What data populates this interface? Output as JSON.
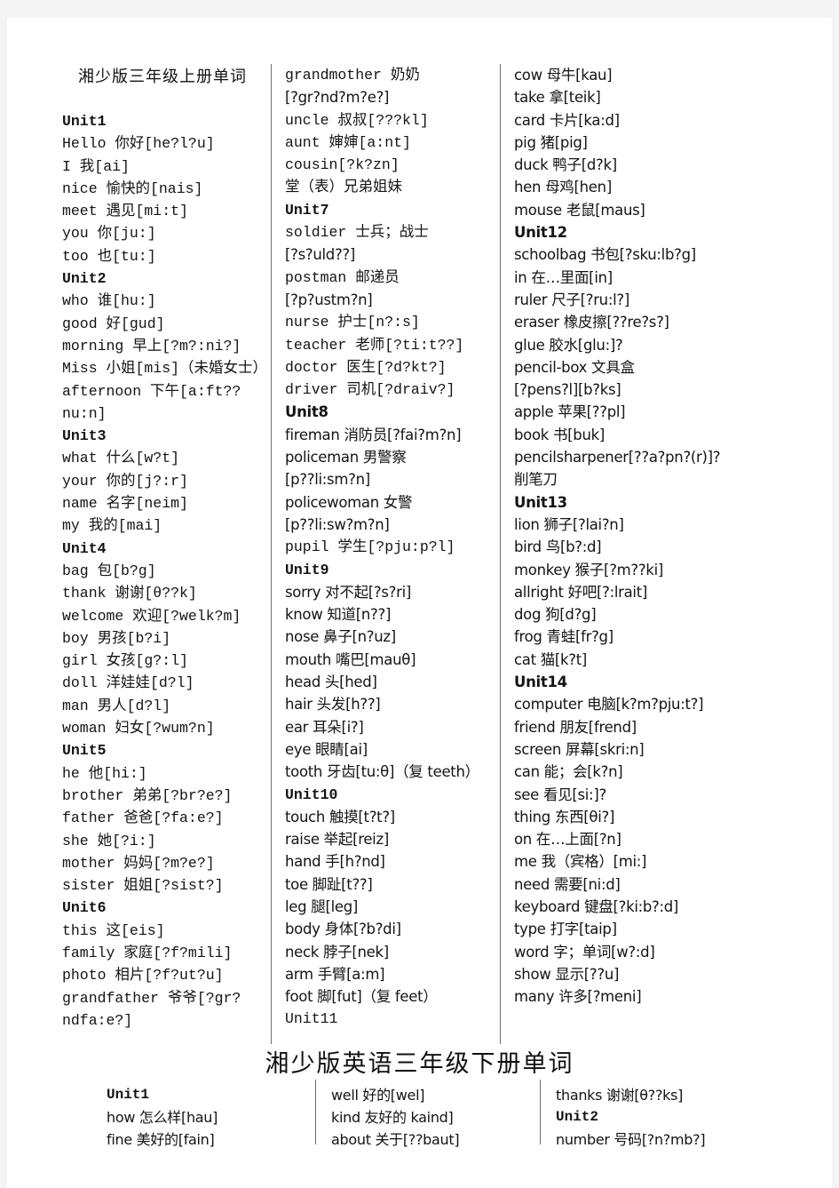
{
  "page": {
    "background": "#ffffff",
    "surround": "#f4f4f4",
    "text_color": "#141414",
    "rule_color": "#6f6f6f"
  },
  "section1": {
    "title": "湘少版三年级上册单词",
    "columns": [
      {
        "name": "column-1",
        "font": "mono",
        "lines": [
          {
            "text": "Unit1",
            "bold": true,
            "font": "mono"
          },
          {
            "text": "Hello 你好[he?l?u]",
            "bold": false,
            "font": "mono"
          },
          {
            "text": "I 我[ai]",
            "bold": false,
            "font": "mono"
          },
          {
            "text": "nice 愉快的[nais]",
            "bold": false,
            "font": "mono"
          },
          {
            "text": "meet 遇见[mi:t]",
            "bold": false,
            "font": "mono"
          },
          {
            "text": "you 你[ju:]",
            "bold": false,
            "font": "mono"
          },
          {
            "text": "too 也[tu:]",
            "bold": false,
            "font": "mono"
          },
          {
            "text": "Unit2",
            "bold": true,
            "font": "mono"
          },
          {
            "text": "who 谁[hu:]",
            "bold": false,
            "font": "mono"
          },
          {
            "text": "good 好[gud]",
            "bold": false,
            "font": "mono"
          },
          {
            "text": "morning 早上[?m?:ni?]",
            "bold": false,
            "font": "mono"
          },
          {
            "text": "Miss 小姐[mis]（未婚女士）",
            "bold": false,
            "font": "mono"
          },
          {
            "text": "afternoon 下午[a:ft??nu:n]",
            "bold": false,
            "font": "mono"
          },
          {
            "text": "Unit3",
            "bold": true,
            "font": "mono"
          },
          {
            "text": "what 什么[w?t]",
            "bold": false,
            "font": "mono"
          },
          {
            "text": "your 你的[j?:r]",
            "bold": false,
            "font": "mono"
          },
          {
            "text": "name 名字[neim]",
            "bold": false,
            "font": "mono"
          },
          {
            "text": "my 我的[mai]",
            "bold": false,
            "font": "mono"
          },
          {
            "text": "Unit4",
            "bold": true,
            "font": "mono"
          },
          {
            "text": "bag 包[b?g]",
            "bold": false,
            "font": "mono"
          },
          {
            "text": "thank 谢谢[θ??k]",
            "bold": false,
            "font": "mono"
          },
          {
            "text": "welcome 欢迎[?welk?m]",
            "bold": false,
            "font": "mono"
          },
          {
            "text": "boy 男孩[b?i]",
            "bold": false,
            "font": "mono"
          },
          {
            "text": "girl 女孩[g?:l]",
            "bold": false,
            "font": "mono"
          },
          {
            "text": "doll 洋娃娃[d?l]",
            "bold": false,
            "font": "mono"
          },
          {
            "text": "man 男人[d?l]",
            "bold": false,
            "font": "mono"
          },
          {
            "text": "woman 妇女[?wum?n]",
            "bold": false,
            "font": "mono"
          },
          {
            "text": "Unit5",
            "bold": true,
            "font": "mono"
          },
          {
            "text": "he 他[hi:]",
            "bold": false,
            "font": "mono"
          },
          {
            "text": "brother 弟弟[?br?e?]",
            "bold": false,
            "font": "mono"
          },
          {
            "text": "father 爸爸[?fa:e?]",
            "bold": false,
            "font": "mono"
          },
          {
            "text": "she 她[?i:]",
            "bold": false,
            "font": "mono"
          },
          {
            "text": "mother 妈妈[?m?e?]",
            "bold": false,
            "font": "mono"
          },
          {
            "text": "sister 姐姐[?sist?]",
            "bold": false,
            "font": "mono"
          },
          {
            "text": "Unit6",
            "bold": true,
            "font": "mono"
          },
          {
            "text": "this 这[eis]",
            "bold": false,
            "font": "mono"
          },
          {
            "text": "family 家庭[?f?mili]",
            "bold": false,
            "font": "mono"
          },
          {
            "text": "photo 相片[?f?ut?u]",
            "bold": false,
            "font": "mono"
          },
          {
            "text": "grandfather 爷爷[?gr?ndfa:e?]",
            "bold": false,
            "font": "mono"
          }
        ]
      },
      {
        "name": "column-2",
        "font": "mixed",
        "lines": [
          {
            "text": "grandmother 奶奶",
            "bold": false,
            "font": "mono"
          },
          {
            "text": "[?gr?nd?m?e?]",
            "bold": false,
            "font": "sans"
          },
          {
            "text": "uncle 叔叔[???kl]",
            "bold": false,
            "font": "mono"
          },
          {
            "text": "aunt 婶婶[a:nt]",
            "bold": false,
            "font": "mono"
          },
          {
            "text": "cousin[?k?zn]",
            "bold": false,
            "font": "mono"
          },
          {
            "text": "堂（表）兄弟姐妹",
            "bold": false,
            "font": "mono"
          },
          {
            "text": "Unit7",
            "bold": true,
            "font": "mono"
          },
          {
            "text": "soldier 士兵；战士",
            "bold": false,
            "font": "mono"
          },
          {
            "text": "[?s?uld??]",
            "bold": false,
            "font": "sans"
          },
          {
            "text": "postman 邮递员",
            "bold": false,
            "font": "mono"
          },
          {
            "text": "[?p?ustm?n]",
            "bold": false,
            "font": "sans"
          },
          {
            "text": "nurse 护士[n?:s]",
            "bold": false,
            "font": "mono"
          },
          {
            "text": "teacher 老师[?ti:t??]",
            "bold": false,
            "font": "mono"
          },
          {
            "text": "doctor 医生[?d?kt?]",
            "bold": false,
            "font": "mono"
          },
          {
            "text": "driver 司机[?draiv?]",
            "bold": false,
            "font": "mono"
          },
          {
            "text": "Unit8",
            "bold": true,
            "font": "sans"
          },
          {
            "text": "fireman 消防员[?fai?m?n]",
            "bold": false,
            "font": "sans"
          },
          {
            "text": "policeman 男警察",
            "bold": false,
            "font": "sans"
          },
          {
            "text": "[p??li:sm?n]",
            "bold": false,
            "font": "sans"
          },
          {
            "text": "policewoman 女警",
            "bold": false,
            "font": "sans"
          },
          {
            "text": "[p??li:sw?m?n]",
            "bold": false,
            "font": "sans"
          },
          {
            "text": "pupil 学生[?pju:p?l]",
            "bold": false,
            "font": "mono"
          },
          {
            "text": "Unit9",
            "bold": true,
            "font": "mono"
          },
          {
            "text": "sorry 对不起[?s?ri]",
            "bold": false,
            "font": "sans"
          },
          {
            "text": "know 知道[n??]",
            "bold": false,
            "font": "sans"
          },
          {
            "text": "nose 鼻子[n?uz]",
            "bold": false,
            "font": "sans"
          },
          {
            "text": "mouth 嘴巴[mauθ]",
            "bold": false,
            "font": "sans"
          },
          {
            "text": "head 头[hed]",
            "bold": false,
            "font": "sans"
          },
          {
            "text": "hair 头发[h??]",
            "bold": false,
            "font": "sans"
          },
          {
            "text": "ear 耳朵[i?]",
            "bold": false,
            "font": "sans"
          },
          {
            "text": "eye 眼睛[ai]",
            "bold": false,
            "font": "sans"
          },
          {
            "text": "tooth 牙齿[tu:θ]（复 teeth）",
            "bold": false,
            "font": "sans"
          },
          {
            "text": "Unit10",
            "bold": true,
            "font": "mono"
          },
          {
            "text": "touch 触摸[t?t?]",
            "bold": false,
            "font": "sans"
          },
          {
            "text": "raise 举起[reiz]",
            "bold": false,
            "font": "sans"
          },
          {
            "text": "hand 手[h?nd]",
            "bold": false,
            "font": "sans"
          },
          {
            "text": "toe 脚趾[t??]",
            "bold": false,
            "font": "sans"
          },
          {
            "text": "leg 腿[leg]",
            "bold": false,
            "font": "sans"
          },
          {
            "text": "body 身体[?b?di]",
            "bold": false,
            "font": "sans"
          },
          {
            "text": "neck 脖子[nek]",
            "bold": false,
            "font": "sans"
          },
          {
            "text": "arm 手臂[a:m]",
            "bold": false,
            "font": "sans"
          },
          {
            "text": "foot 脚[fut]（复 feet）",
            "bold": false,
            "font": "sans"
          },
          {
            "text": "Unit11",
            "bold": false,
            "font": "mono"
          }
        ]
      },
      {
        "name": "column-3",
        "font": "sans",
        "lines": [
          {
            "text": "cow 母牛[kau]",
            "bold": false,
            "font": "sans"
          },
          {
            "text": "take 拿[teik]",
            "bold": false,
            "font": "sans"
          },
          {
            "text": "card 卡片[ka:d]",
            "bold": false,
            "font": "sans"
          },
          {
            "text": "pig 猪[pig]",
            "bold": false,
            "font": "sans"
          },
          {
            "text": "duck 鸭子[d?k]",
            "bold": false,
            "font": "sans"
          },
          {
            "text": "hen 母鸡[hen]",
            "bold": false,
            "font": "sans"
          },
          {
            "text": "mouse 老鼠[maus]",
            "bold": false,
            "font": "sans"
          },
          {
            "text": "Unit12",
            "bold": true,
            "font": "sans"
          },
          {
            "text": "schoolbag 书包[?sku:lb?g]",
            "bold": false,
            "font": "sans"
          },
          {
            "text": "in 在…里面[in]",
            "bold": false,
            "font": "sans"
          },
          {
            "text": "ruler 尺子[?ru:l?]",
            "bold": false,
            "font": "sans"
          },
          {
            "text": "eraser 橡皮擦[??re?s?]",
            "bold": false,
            "font": "sans"
          },
          {
            "text": "glue 胶水[glu:]?",
            "bold": false,
            "font": "sans"
          },
          {
            "text": "pencil-box 文具盒",
            "bold": false,
            "font": "sans"
          },
          {
            "text": "[?pens?l][b?ks]",
            "bold": false,
            "font": "sans"
          },
          {
            "text": "apple 苹果[??pl]",
            "bold": false,
            "font": "sans"
          },
          {
            "text": "book 书[buk]",
            "bold": false,
            "font": "sans"
          },
          {
            "text": "pencilsharpener[??a?pn?(r)]?",
            "bold": false,
            "font": "sans"
          },
          {
            "text": "削笔刀",
            "bold": false,
            "font": "sans"
          },
          {
            "text": "Unit13",
            "bold": true,
            "font": "sans"
          },
          {
            "text": "lion 狮子[?lai?n]",
            "bold": false,
            "font": "sans"
          },
          {
            "text": "bird 鸟[b?:d]",
            "bold": false,
            "font": "sans"
          },
          {
            "text": "monkey 猴子[?m??ki]",
            "bold": false,
            "font": "sans"
          },
          {
            "text": "allright 好吧[?:lrait]",
            "bold": false,
            "font": "sans"
          },
          {
            "text": "dog 狗[d?g]",
            "bold": false,
            "font": "sans"
          },
          {
            "text": "frog 青蛙[fr?g]",
            "bold": false,
            "font": "sans"
          },
          {
            "text": "cat 猫[k?t]",
            "bold": false,
            "font": "sans"
          },
          {
            "text": "Unit14",
            "bold": true,
            "font": "sans"
          },
          {
            "text": "computer 电脑[k?m?pju:t?]",
            "bold": false,
            "font": "sans"
          },
          {
            "text": "friend 朋友[frend]",
            "bold": false,
            "font": "sans"
          },
          {
            "text": "screen 屏幕[skri:n]",
            "bold": false,
            "font": "sans"
          },
          {
            "text": "can 能；会[k?n]",
            "bold": false,
            "font": "sans"
          },
          {
            "text": "see 看见[si:]?",
            "bold": false,
            "font": "sans"
          },
          {
            "text": "thing 东西[θi?]",
            "bold": false,
            "font": "sans"
          },
          {
            "text": "on 在…上面[?n]",
            "bold": false,
            "font": "sans"
          },
          {
            "text": "me 我（宾格）[mi:]",
            "bold": false,
            "font": "sans"
          },
          {
            "text": "need 需要[ni:d]",
            "bold": false,
            "font": "sans"
          },
          {
            "text": "keyboard 键盘[?ki:b?:d]",
            "bold": false,
            "font": "sans"
          },
          {
            "text": "type 打字[taip]",
            "bold": false,
            "font": "sans"
          },
          {
            "text": "word 字；单词[w?:d]",
            "bold": false,
            "font": "sans"
          },
          {
            "text": "show 显示[??u]",
            "bold": false,
            "font": "sans"
          },
          {
            "text": "many 许多[?meni]",
            "bold": false,
            "font": "sans"
          }
        ]
      }
    ]
  },
  "section2": {
    "title": "湘少版英语三年级下册单词",
    "columns": [
      {
        "name": "column-1",
        "lines": [
          {
            "text": "Unit1",
            "bold": true,
            "font": "mono"
          },
          {
            "text": "how 怎么样[hau]",
            "bold": false,
            "font": "sans"
          },
          {
            "text": "fine 美好的[fain]",
            "bold": false,
            "font": "sans"
          }
        ]
      },
      {
        "name": "column-2",
        "lines": [
          {
            "text": "well 好的[wel]",
            "bold": false,
            "font": "sans"
          },
          {
            "text": "kind 友好的 kaind]",
            "bold": false,
            "font": "sans"
          },
          {
            "text": "about 关于[??baut]",
            "bold": false,
            "font": "sans"
          }
        ]
      },
      {
        "name": "column-3",
        "lines": [
          {
            "text": "thanks 谢谢[θ??ks]",
            "bold": false,
            "font": "sans"
          },
          {
            "text": "Unit2",
            "bold": true,
            "font": "mono"
          },
          {
            "text": "number 号码[?n?mb?]",
            "bold": false,
            "font": "sans"
          }
        ]
      }
    ]
  }
}
